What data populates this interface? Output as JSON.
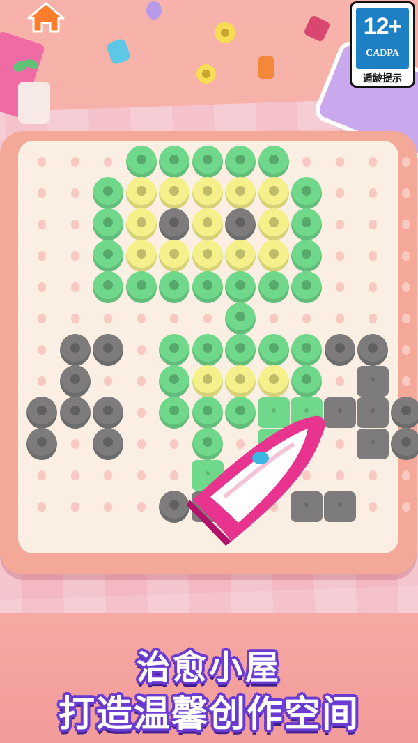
{
  "header": {
    "home_icon": "home-icon",
    "rating": {
      "age": "12+",
      "org": "CADPA",
      "hint": "适龄提示"
    }
  },
  "slogan": {
    "line1": "治愈小屋",
    "line2": "打造温馨创作空间"
  },
  "colors": {
    "green": "#6fd88a",
    "yellow": "#f5f08a",
    "gray": "#7d7b7b",
    "accent": "#e8338f",
    "text_outline": "#6a3bd1"
  },
  "board": {
    "rows": [
      "...GGGGG....",
      "..GYYYYYG...",
      "..GYKYKYG...",
      "..GYYYYYG...",
      "..GGGGGGG...",
      "......G.....",
      ".KK.GGGGGKK.",
      ".K..GYYYG.Q.",
      "KKK.GGGQQQQK",
      "K.K..G.Q..QK",
      ".....Q......",
      "....KQ..QQ.."
    ],
    "legend": {
      "G": "green bead",
      "Y": "yellow bead",
      "K": "gray bead",
      "Q": "ironed bead",
      ".": "empty peg"
    }
  }
}
